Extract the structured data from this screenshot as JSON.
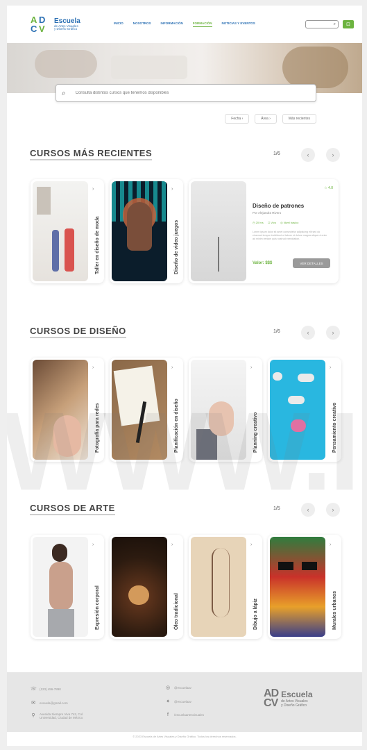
{
  "brand": {
    "mark_a": "A",
    "mark_d": "D",
    "mark_c": "C",
    "mark_v": "V",
    "name": "Escuela",
    "line2": "de Artes Visuales",
    "line3": "y Diseño Gráfico",
    "color_green": "#6cb33f",
    "color_blue": "#2a6fb3"
  },
  "nav": {
    "items": [
      {
        "label": "INICIO"
      },
      {
        "label": "NOSOTROS"
      },
      {
        "label": "INFORMACIÓN"
      },
      {
        "label": "FORMACIÓN"
      },
      {
        "label": "NOTICIAS Y EVENTOS"
      }
    ],
    "active_index": 3,
    "search_icon": "search-icon",
    "cart_icon": "cart-icon"
  },
  "search": {
    "placeholder": "Consulta distintos cursos que tenemos disponibles",
    "icon": "search-icon"
  },
  "filters": [
    {
      "label": "Fecha ›"
    },
    {
      "label": "Área ›"
    },
    {
      "label": "Más recientes"
    }
  ],
  "sections": {
    "recientes": {
      "title": "CURSOS MÁS RECIENTES",
      "count": "1/6",
      "cards": [
        {
          "label": "Taller en diseño de moda"
        },
        {
          "label": "Diseño de video juegos"
        }
      ],
      "featured": {
        "rating": "☆ 4.8",
        "title": "Diseño de patrones",
        "author": "Por Alejandra Rivero",
        "meta": [
          "◷ 20 hrs",
          "☐ Vivo",
          "◎ Nivel básico"
        ],
        "description": "Lorem ipsum dolor sit amet consectetur adipiscing elit sed do eiusmod tempor incididunt ut labore et dolore magna aliqua ut enim ad minim veniam quis nostrud exercitation.",
        "price": "Valor: $$$",
        "button": "VER DETALLES"
      }
    },
    "diseno": {
      "title": "CURSOS DE DISEÑO",
      "count": "1/6",
      "cards": [
        {
          "label": "Fotografía para redes"
        },
        {
          "label": "Planificación en diseño"
        },
        {
          "label": "Planning creativo"
        },
        {
          "label": "Pensamiento creativo"
        }
      ]
    },
    "arte": {
      "title": "CURSOS DE ARTE",
      "count": "1/5",
      "cards": [
        {
          "label": "Expresión corporal"
        },
        {
          "label": "Óleo tradicional"
        },
        {
          "label": "Dibujo a lápiz"
        },
        {
          "label": "Murales urbanos"
        }
      ]
    }
  },
  "watermark": "WWW.I",
  "footer": {
    "phone": "(123) 456-7890",
    "email": "escuela@gmail.com",
    "address_line1": "Avenida Siempre Viva 742, Col.",
    "address_line2": "Universidad, Ciudad de México",
    "instagram": "@escuelaav",
    "twitter": "@escuelaav",
    "facebook": "/escuelaartesvisuales",
    "copyright": "© 2023 Escuela de Artes Visuales y Diseño Gráfico. Todos los derechos reservados."
  }
}
